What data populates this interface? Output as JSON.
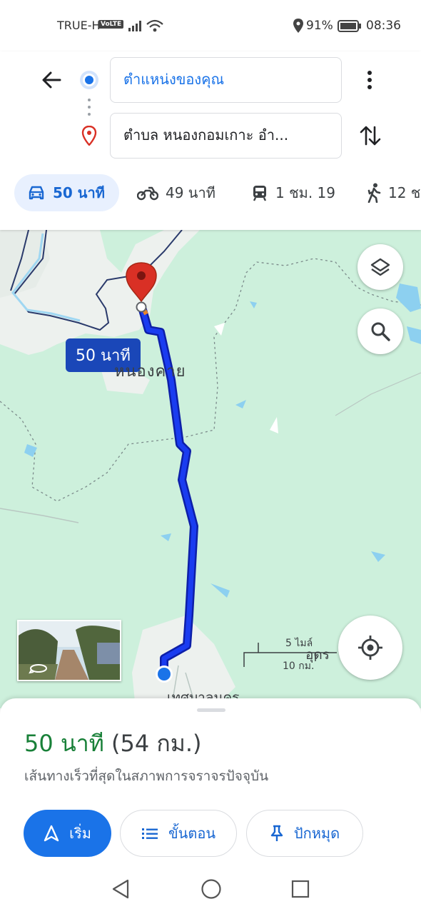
{
  "status_bar": {
    "carrier": "TRUE-H",
    "volte": "VoLTE",
    "battery": "91%",
    "time": "08:36"
  },
  "directions": {
    "origin": "ตำแหน่งของคุณ",
    "destination": "ตำบล หนองกอมเกาะ อำ..."
  },
  "modes": [
    {
      "icon": "car-icon",
      "label": "50 นาที",
      "selected": true
    },
    {
      "icon": "motorcycle-icon",
      "label": "49 นาที"
    },
    {
      "icon": "transit-icon",
      "label": "1 ชม. 19"
    },
    {
      "icon": "walk-icon",
      "label": "12 ช"
    }
  ],
  "map": {
    "route_time_label": "50 นาที",
    "place_label": "หนองคาย",
    "city_label": "เทศบาลนคร",
    "city_label_2": "อุดร",
    "scale_mi": "5 ไมล์",
    "scale_km": "10 กม."
  },
  "sheet": {
    "time": "50 นาที",
    "distance": "(54 กม.)",
    "note": "เส้นทางเร็วที่สุดในสภาพการจราจรปัจจุบัน",
    "start_label": "เริ่ม",
    "steps_label": "ขั้นตอน",
    "pin_label": "ปักหมุด"
  },
  "colors": {
    "accent": "#1a73e8",
    "route": "#1a1fe0",
    "duration_green": "#188038",
    "pin_red": "#d93025",
    "map_green": "#cdf0dc"
  }
}
